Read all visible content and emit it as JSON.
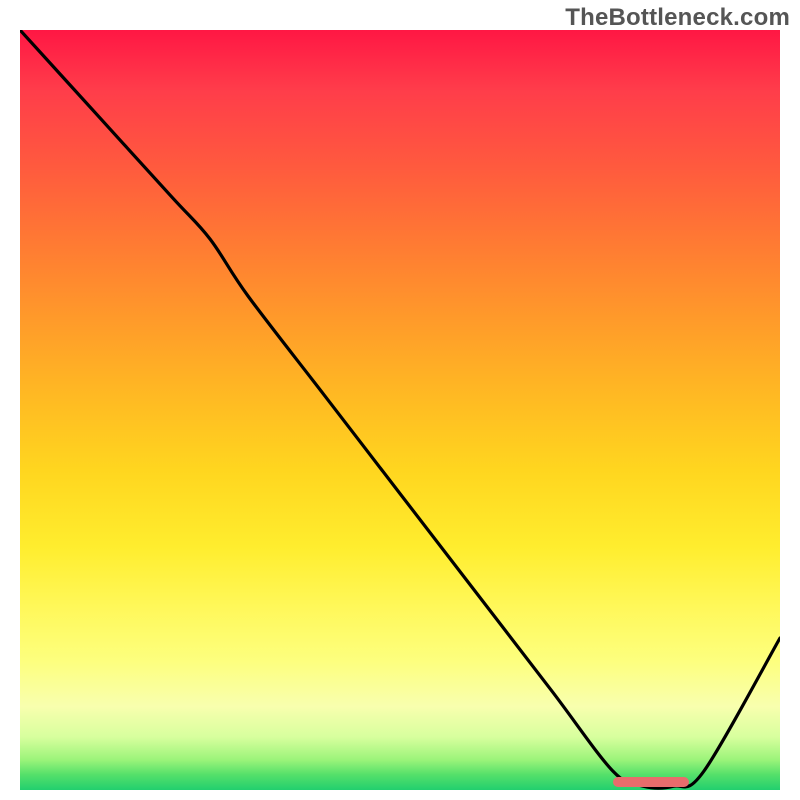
{
  "watermark": "TheBottleneck.com",
  "colors": {
    "gradient_top": "#ff1744",
    "gradient_mid": "#ffd61f",
    "gradient_bottom": "#22cf6e",
    "curve": "#000000",
    "marker": "#e86c6c",
    "watermark_text": "#555555"
  },
  "chart_data": {
    "type": "line",
    "title": "",
    "xlabel": "",
    "ylabel": "",
    "xlim": [
      0,
      100
    ],
    "ylim": [
      0,
      100
    ],
    "legend": false,
    "grid": false,
    "annotations": [],
    "series": [
      {
        "name": "curve",
        "x": [
          0,
          10,
          20,
          25,
          30,
          40,
          50,
          60,
          70,
          78,
          82,
          86,
          90,
          100
        ],
        "y": [
          100,
          89,
          78,
          72.5,
          65,
          52,
          39,
          26,
          13,
          2.5,
          0.5,
          0.5,
          2.5,
          20
        ]
      }
    ],
    "marker": {
      "x_start": 78,
      "x_end": 88,
      "y": 1
    }
  }
}
